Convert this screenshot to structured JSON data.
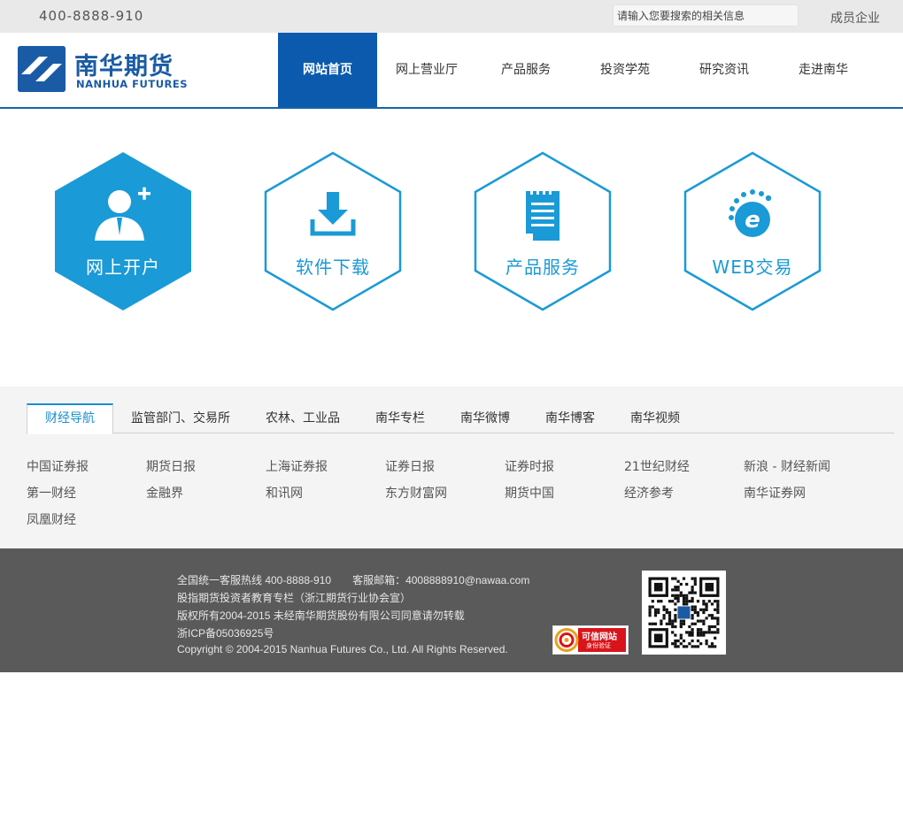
{
  "topbar": {
    "hotline": "400-8888-910",
    "search_placeholder": "请输入您要搜索的相关信息",
    "members_link": "成员企业"
  },
  "brand": {
    "name_cn": "南华期货",
    "name_en": "NANHUA FUTURES",
    "color": "#1a5ba5"
  },
  "nav": {
    "items": [
      {
        "label": "网站首页",
        "active": true
      },
      {
        "label": "网上营业厅"
      },
      {
        "label": "产品服务"
      },
      {
        "label": "投资学苑"
      },
      {
        "label": "研究资讯"
      },
      {
        "label": "走进南华"
      }
    ],
    "active_color": "#0b5aad"
  },
  "tiles": [
    {
      "label": "网上开户",
      "icon": "user-add-icon",
      "filled": true
    },
    {
      "label": "软件下载",
      "icon": "download-icon",
      "filled": false
    },
    {
      "label": "产品服务",
      "icon": "notepad-icon",
      "filled": false
    },
    {
      "label": "WEB交易",
      "icon": "web-e-icon",
      "filled": false
    }
  ],
  "tile_color": "#1a9ad6",
  "links_panel": {
    "tabs": [
      {
        "label": "财经导航",
        "active": true
      },
      {
        "label": "监管部门、交易所"
      },
      {
        "label": "农林、工业品"
      },
      {
        "label": "南华专栏"
      },
      {
        "label": "南华微博"
      },
      {
        "label": "南华博客"
      },
      {
        "label": "南华视频"
      }
    ],
    "links": [
      "中国证券报",
      "期货日报",
      "上海证券报",
      "证券日报",
      "证券时报",
      "21世纪财经",
      "新浪 - 财经新闻",
      "第一财经",
      "金融界",
      "和讯网",
      "东方财富网",
      "期货中国",
      "经济参考",
      "南华证券网",
      "凤凰财经"
    ],
    "accent": "#1a8fd0"
  },
  "footer": {
    "lines": [
      "全国统一客服热线 400-8888-910　　客服邮箱：4008888910@nawaa.com",
      "股指期货投资者教育专栏（浙江期货行业协会宣）",
      "版权所有2004-2015 未经南华期货股份有限公司同意请勿转载",
      "浙ICP备05036925号",
      "Copyright © 2004-2015 Nanhua Futures Co., Ltd. All Rights Reserved."
    ],
    "badge_text": "可信网站",
    "badge_subtext": "身份验证"
  }
}
